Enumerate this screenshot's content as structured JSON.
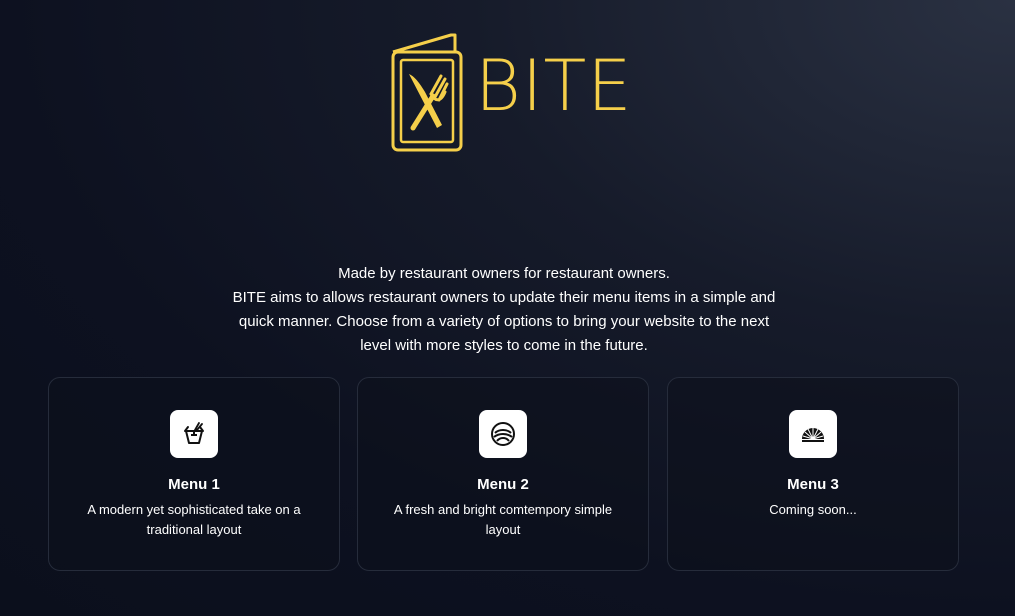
{
  "brand": {
    "name": "BITE",
    "color": "#f5cf4a"
  },
  "intro": {
    "line1": "Made by restaurant owners for restaurant owners.",
    "line2": "BITE aims to allows restaurant owners to update their menu items in a simple and quick manner. Choose from a variety of options to bring your website to the next level with more styles to come in the future."
  },
  "menus": [
    {
      "title": "Menu 1",
      "description": "A modern yet sophisticated take on a traditional layout",
      "icon": "takeout-box-icon"
    },
    {
      "title": "Menu 2",
      "description": "A fresh and bright comtempory simple layout",
      "icon": "bowl-waves-icon"
    },
    {
      "title": "Menu 3",
      "description": "Coming soon...",
      "icon": "sunrise-fan-icon"
    }
  ]
}
